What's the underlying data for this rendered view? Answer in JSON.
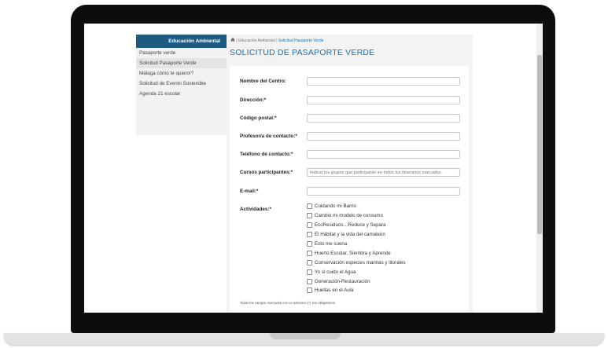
{
  "sidebar": {
    "header": "Educación Ambiental",
    "items": [
      {
        "label": "Pasaporte verde"
      },
      {
        "label": "Solicitud Pasaporte Verde"
      },
      {
        "label": "Málaga cómo te quiero!?"
      },
      {
        "label": "Solicitud de Evento Sostenible"
      },
      {
        "label": "Agenda 21 escolar"
      }
    ]
  },
  "breadcrumb": {
    "sep1": "|",
    "section": "Educación Ambiental",
    "sep2": "|",
    "current": "Solicitud Pasaporte Verde"
  },
  "page_title": "SOLICITUD DE PASAPORTE VERDE",
  "form": {
    "centro_label": "Nombre del Centro:",
    "direccion_label": "Dirección:*",
    "cp_label": "Código postal:*",
    "profesor_label": "Profesor/a de contacto:*",
    "telefono_label": "Teléfono de contacto:*",
    "cursos_label": "Cursos participantes:*",
    "cursos_placeholder": "Indicar los grupos que participarán en todos los itinerarios marcados",
    "email_label": "E-mail:*",
    "actividades_label": "Actividades:*",
    "actividades": [
      "Cuidando mi Barrio",
      "Cambio mi modelo de consumo",
      "EcoResiduos…Reduce y Separa",
      "El Hábitat y la vida del camaleón",
      "Esto me suena",
      "Huerto Escolar. Siembra y Aprende",
      "Conservación especies marinas y litorales",
      "Yo sí cuido el Agua",
      "Generación-Restauración",
      "Huellas en el Aula"
    ],
    "footnote": "Todos los campos marcados con un asterisco (*) son obligatorios."
  },
  "colors": {
    "accent": "#1f6fa8",
    "sidebar_header_bg": "#1f5b80",
    "frame": "#0d0d0d"
  }
}
